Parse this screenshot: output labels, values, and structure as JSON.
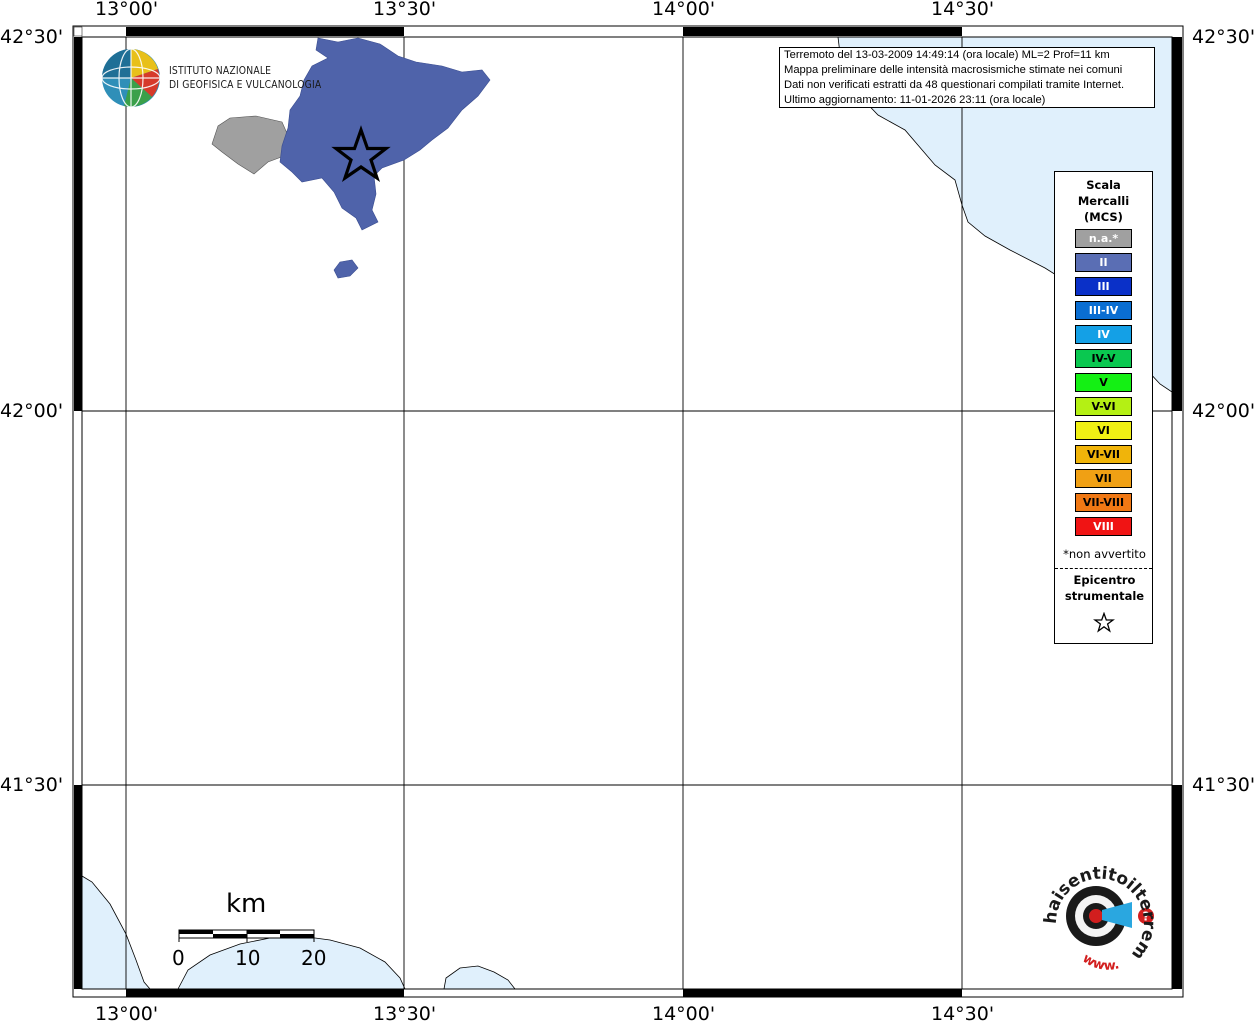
{
  "map": {
    "lon_labels": [
      "13°00'",
      "13°30'",
      "14°00'",
      "14°30'"
    ],
    "lat_labels": [
      "42°30'",
      "42°00'",
      "41°30'"
    ]
  },
  "info_box": {
    "line1": "Terremoto del 13-03-2009 14:49:14 (ora locale) ML=2 Prof=11 km",
    "line2": "Mappa preliminare delle intensità macrosismiche stimate nei comuni",
    "line3": "Dati non verificati estratti da 48 questionari compilati tramite Internet.",
    "line4": "Ultimo aggiornamento: 11-01-2026 23:11 (ora locale)"
  },
  "logo": {
    "line1": "ISTITUTO NAZIONALE",
    "line2": "DI GEOFISICA E VULCANOLOGIA"
  },
  "legend": {
    "title1": "Scala",
    "title2": "Mercalli",
    "title3": "(MCS)",
    "items": [
      {
        "label": "n.a.*",
        "color": "#a0a0a0",
        "text_color": "#ffffff"
      },
      {
        "label": "II",
        "color": "#5a6eb4",
        "text_color": "#ffffff"
      },
      {
        "label": "III",
        "color": "#0a30c8",
        "text_color": "#ffffff"
      },
      {
        "label": "III-IV",
        "color": "#0a6ed2",
        "text_color": "#ffffff"
      },
      {
        "label": "IV",
        "color": "#14a0e6",
        "text_color": "#ffffff"
      },
      {
        "label": "IV-V",
        "color": "#0ac850",
        "text_color": "#000000"
      },
      {
        "label": "V",
        "color": "#14f014",
        "text_color": "#000000"
      },
      {
        "label": "V-VI",
        "color": "#b4f014",
        "text_color": "#000000"
      },
      {
        "label": "VI",
        "color": "#f0f014",
        "text_color": "#000000"
      },
      {
        "label": "VI-VII",
        "color": "#f0b40a",
        "text_color": "#000000"
      },
      {
        "label": "VII",
        "color": "#f0a014",
        "text_color": "#000000"
      },
      {
        "label": "VII-VIII",
        "color": "#f07814",
        "text_color": "#000000"
      },
      {
        "label": "VIII",
        "color": "#f01414",
        "text_color": "#ffffff"
      }
    ],
    "note": "*non avvertito",
    "epicenter1": "Epicentro",
    "epicenter2": "strumentale"
  },
  "scale_bar": {
    "title": "km",
    "labels": [
      "0",
      "10",
      "20"
    ]
  },
  "colors": {
    "region_ii": "#4f63aa",
    "region_na": "#a0a0a0",
    "sea": "#e0f0fc"
  },
  "badge": {
    "text": "haisentitoilterremoto.it",
    "url": "www."
  }
}
